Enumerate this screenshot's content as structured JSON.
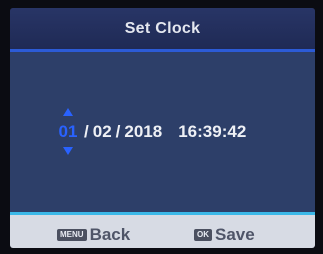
{
  "title": "Set Clock",
  "datetime": {
    "month": "01",
    "day": "02",
    "year": "2018",
    "separator": "/",
    "time": "16:39:42"
  },
  "footer": {
    "back_key": "MENU",
    "back_label": "Back",
    "save_key": "OK",
    "save_label": "Save"
  },
  "colors": {
    "accent_blue": "#2962ff",
    "title_bg": "#1f2a55",
    "content_bg": "#2d3f69",
    "footer_bg": "#d7dbe4",
    "divider": "#3bb8e8"
  }
}
